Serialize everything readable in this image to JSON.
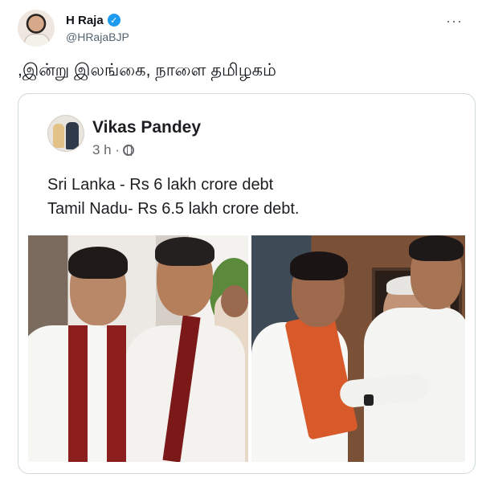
{
  "tweet": {
    "display_name": "H Raja",
    "handle": "@HRajaBJP",
    "verified_icon": "verified-badge-icon",
    "more_icon": "more-options-icon",
    "text": ",இன்று இலங்கை, நாளை தமிழகம்"
  },
  "quoted_post": {
    "author": "Vikas Pandey",
    "time": "3 h ·",
    "privacy_icon": "globe-icon",
    "lines": [
      "Sri Lanka - Rs 6 lakh crore debt",
      "Tamil Nadu- Rs 6.5 lakh crore debt."
    ]
  },
  "colors": {
    "verified_blue": "#1d9bf0",
    "secondary_text": "#536471",
    "border": "#cfd9de"
  }
}
